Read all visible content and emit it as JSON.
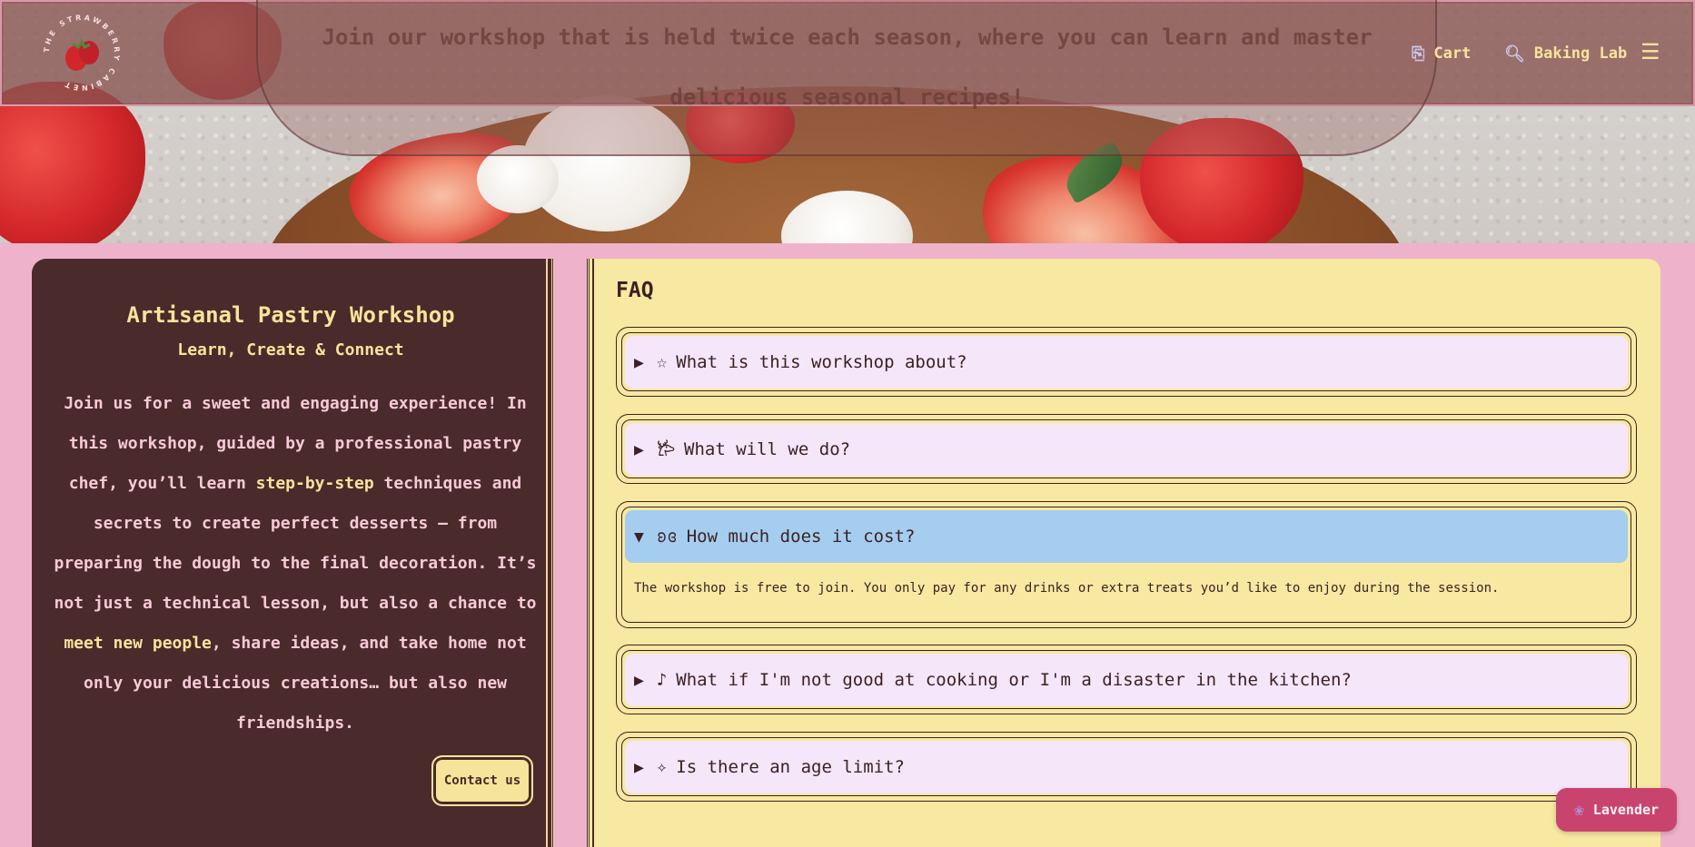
{
  "brand": {
    "logo_text": "THE STRAWBERRY CABINET"
  },
  "announcement": {
    "text": "Join our workshop that is held twice each season, where you can learn and master delicious seasonal recipes!"
  },
  "nav": {
    "cart_label": "Cart",
    "cart_icon": "cart-icon",
    "lab_label": "Baking Lab",
    "lab_icon": "magnifier-icon",
    "menu_icon": "hamburger-icon",
    "menu_glyph": "☰"
  },
  "workshop": {
    "title": "Artisanal Pastry Workshop",
    "subtitle": "Learn, Create & Connect",
    "body_parts": [
      "Join us for a sweet and engaging experience! In this workshop, guided by a professional pastry chef, you’ll learn ",
      "step-by-step",
      " techniques and secrets to create perfect desserts – from preparing the dough to the final decoration. It’s not just a technical lesson, but also a chance to ",
      "meet new people",
      ", share ideas, and take home not only your delicious creations… but also new friendships."
    ],
    "contact_label": "Contact us"
  },
  "faq": {
    "title": "FAQ",
    "items": [
      {
        "arrow": "▶",
        "icon": "☆",
        "question": "What is this workshop about?",
        "open": false
      },
      {
        "arrow": "▶",
        "icon": "𐂂",
        "question": "What will we do?",
        "open": false
      },
      {
        "arrow": "▼",
        "icon": "ʚɞ",
        "question": "How much does it cost?",
        "open": true,
        "answer": "The workshop is free to join. You only pay for any drinks or extra treats you’d like to enjoy during the session."
      },
      {
        "arrow": "▶",
        "icon": "♪",
        "question": "What if I'm not good at cooking or I'm a disaster in the kitchen?",
        "open": false
      },
      {
        "arrow": "▶",
        "icon": "✧",
        "question": "Is there an age limit?",
        "open": false
      }
    ]
  },
  "theme_switch": {
    "label": "Lavender",
    "icon": "lavender-flower-icon"
  },
  "colors": {
    "page_bg": "#eeb3cb",
    "brown": "#4a2a2a",
    "yellow": "#f7e49b",
    "faq_bg": "#f7e8a2",
    "question_bg": "#f5e6fa",
    "open_question_bg": "#a5cdf0",
    "accent_pink": "#c8446e"
  }
}
